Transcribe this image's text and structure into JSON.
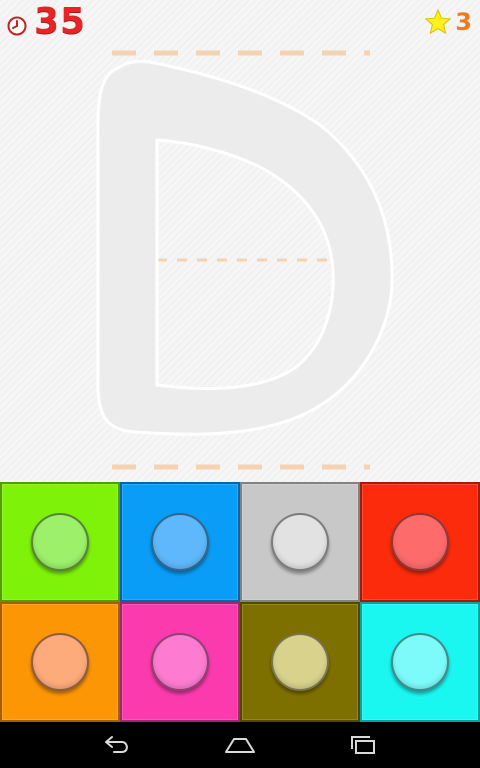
{
  "hud": {
    "timer_value": "35",
    "stars_count": "3",
    "icons": {
      "timer": "clock-icon",
      "stars": "star-icon"
    }
  },
  "trace": {
    "letter": "D",
    "outline_color": "#ffffff",
    "fill_color": "#ececec",
    "guide_color": "#f4d2b2"
  },
  "palette": {
    "swatches": [
      {
        "name": "lime",
        "bg": "#7ff20a",
        "dot": "#9cf06a"
      },
      {
        "name": "blue",
        "bg": "#0a9df7",
        "dot": "#5fb8fb"
      },
      {
        "name": "gray",
        "bg": "#c8c8c8",
        "dot": "#e2e2e2"
      },
      {
        "name": "red",
        "bg": "#fb2b0b",
        "dot": "#fd6b6b"
      },
      {
        "name": "orange",
        "bg": "#fc9605",
        "dot": "#fdab7b"
      },
      {
        "name": "pink",
        "bg": "#fb3aad",
        "dot": "#fd7bd0"
      },
      {
        "name": "olive",
        "bg": "#7e7000",
        "dot": "#d8d28c"
      },
      {
        "name": "cyan",
        "bg": "#1af6f0",
        "dot": "#7cfbfa"
      }
    ]
  },
  "navbar": {
    "icons": [
      "back-icon",
      "home-icon",
      "recent-apps-icon"
    ]
  }
}
